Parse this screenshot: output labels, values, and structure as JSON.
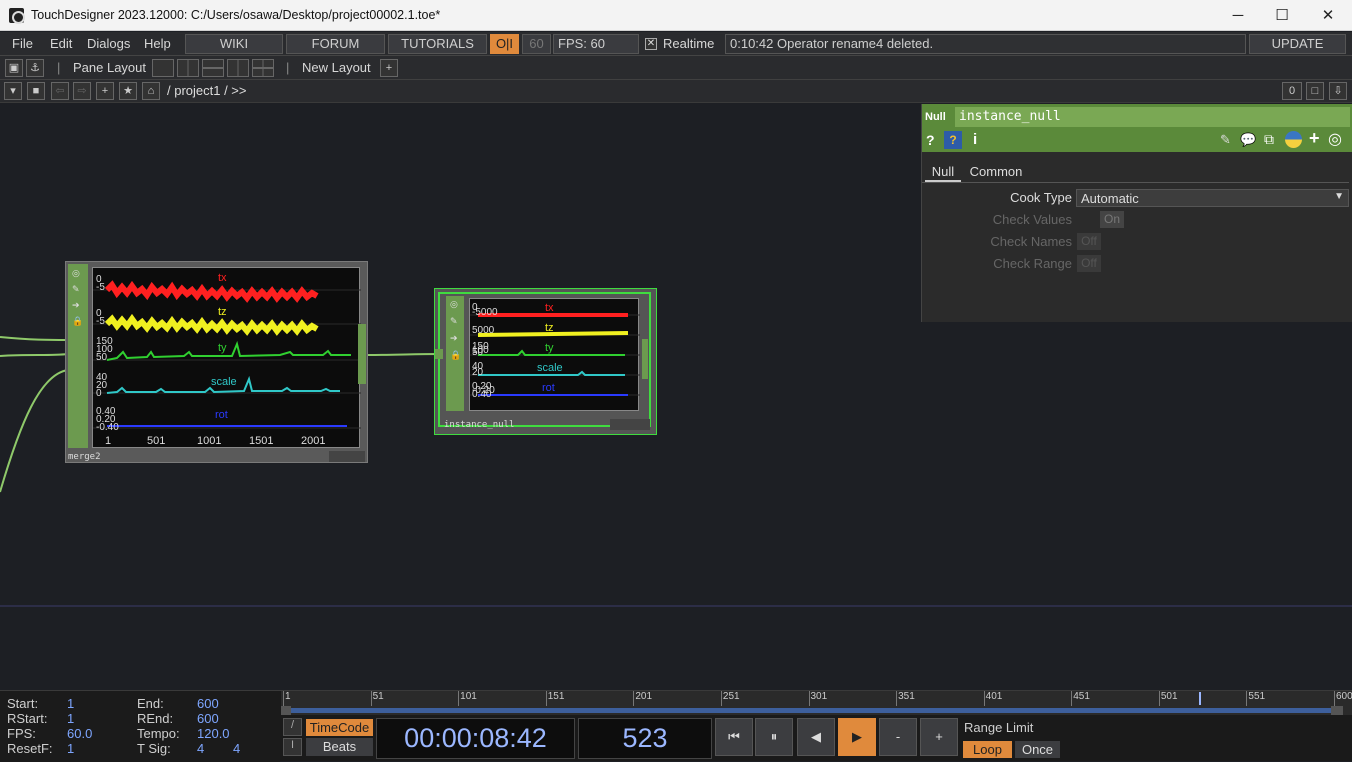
{
  "window": {
    "title": "TouchDesigner 2023.12000: C:/Users/osawa/Desktop/project00002.1.toe*",
    "minimize": "─",
    "maximize": "☐",
    "close": "✕"
  },
  "menu": {
    "file": "File",
    "edit": "Edit",
    "dialogs": "Dialogs",
    "help": "Help",
    "wiki": "WIKI",
    "forum": "FORUM",
    "tutorials": "TUTORIALS",
    "oi": "O|I",
    "fps_cap": "60",
    "fps_label": "FPS:",
    "fps_value": "60",
    "realtime": "Realtime",
    "status": "0:10:42 Operator rename4 deleted.",
    "update": "UPDATE"
  },
  "toolbar": {
    "pane_layout": "Pane Layout",
    "new_layout": "New Layout",
    "path": "/ project1 / >>",
    "counter": "0"
  },
  "merge_node": {
    "name": "merge2",
    "channels": [
      "tx",
      "tz",
      "ty",
      "scale",
      "rot"
    ],
    "xticks": [
      "1",
      "501",
      "1001",
      "1501",
      "2001"
    ],
    "ylabels": [
      "0",
      "-5",
      "0",
      "-5",
      "150",
      "100",
      "50",
      "40",
      "20",
      "0",
      "0.40",
      "0.20",
      "-0.40"
    ]
  },
  "null_node": {
    "name": "instance_null",
    "channels": [
      "tx",
      "tz",
      "ty",
      "scale",
      "rot"
    ],
    "ylabels": [
      "0",
      "-5000",
      "5000",
      "150",
      "100",
      "50",
      "40",
      "20",
      "0.20",
      "-0.20",
      "0.40"
    ]
  },
  "params": {
    "type": "Null",
    "name": "instance_null",
    "tabs": [
      "Null",
      "Common"
    ],
    "cook_type_label": "Cook Type",
    "cook_type_value": "Automatic",
    "check_values_label": "Check Values",
    "check_values_value": "On",
    "check_names_label": "Check Names",
    "check_names_value": "Off",
    "check_range_label": "Check Range",
    "check_range_value": "Off"
  },
  "timeline": {
    "start_label": "Start:",
    "start": "1",
    "end_label": "End:",
    "end": "600",
    "rstart_label": "RStart:",
    "rstart": "1",
    "rend_label": "REnd:",
    "rend": "600",
    "fps_label": "FPS:",
    "fps": "60.0",
    "tempo_label": "Tempo:",
    "tempo": "120.0",
    "resetf_label": "ResetF:",
    "resetf": "1",
    "tsig_label": "T Sig:",
    "tsig1": "4",
    "tsig2": "4",
    "ruler": [
      "1",
      "51",
      "101",
      "151",
      "201",
      "251",
      "301",
      "351",
      "401",
      "451",
      "501",
      "551",
      "600"
    ],
    "current_frame_fraction": 0.8715,
    "timecode_btn": "TimeCode",
    "beats_btn": "Beats",
    "timecode": "00:00:08:42",
    "frame": "523",
    "range_limit": "Range Limit",
    "loop": "Loop",
    "once": "Once",
    "minus": "-",
    "plus": "+"
  },
  "colors": {
    "accent": "#e08a3c",
    "param_header": "#5b8a3a",
    "selected_node": "#3fdc3f",
    "tx": "#ff2020",
    "tz": "#f0f020",
    "ty": "#30d030",
    "scale": "#30c8c8",
    "rot": "#2a3aff"
  }
}
